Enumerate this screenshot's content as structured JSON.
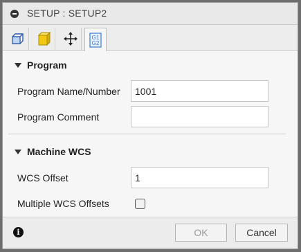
{
  "titlebar": {
    "title": "SETUP : SETUP2",
    "icon": "minus-circle-icon"
  },
  "tabs": [
    {
      "name": "setup-tab",
      "icon": "setup-box-icon",
      "active": false
    },
    {
      "name": "stock-tab",
      "icon": "stock-cube-icon",
      "active": false
    },
    {
      "name": "move-tab",
      "icon": "move-arrows-icon",
      "active": false
    },
    {
      "name": "post-process-tab",
      "icon": "g1-g2-icon",
      "icon_text": [
        "G1",
        "G2"
      ],
      "active": true
    }
  ],
  "program": {
    "header": "Program",
    "name_label": "Program Name/Number",
    "name_value": "1001",
    "comment_label": "Program Comment",
    "comment_value": ""
  },
  "machine_wcs": {
    "header": "Machine WCS",
    "offset_label": "WCS Offset",
    "offset_value": "1",
    "multiple_label": "Multiple WCS Offsets",
    "multiple_checked": false
  },
  "footer": {
    "info_icon": "info-icon",
    "ok_label": "OK",
    "cancel_label": "Cancel"
  },
  "colors": {
    "background": "#f6f6f6",
    "stock_cube_yellow": "#f2c812",
    "g_icon_blue": "#3a7bd5"
  }
}
